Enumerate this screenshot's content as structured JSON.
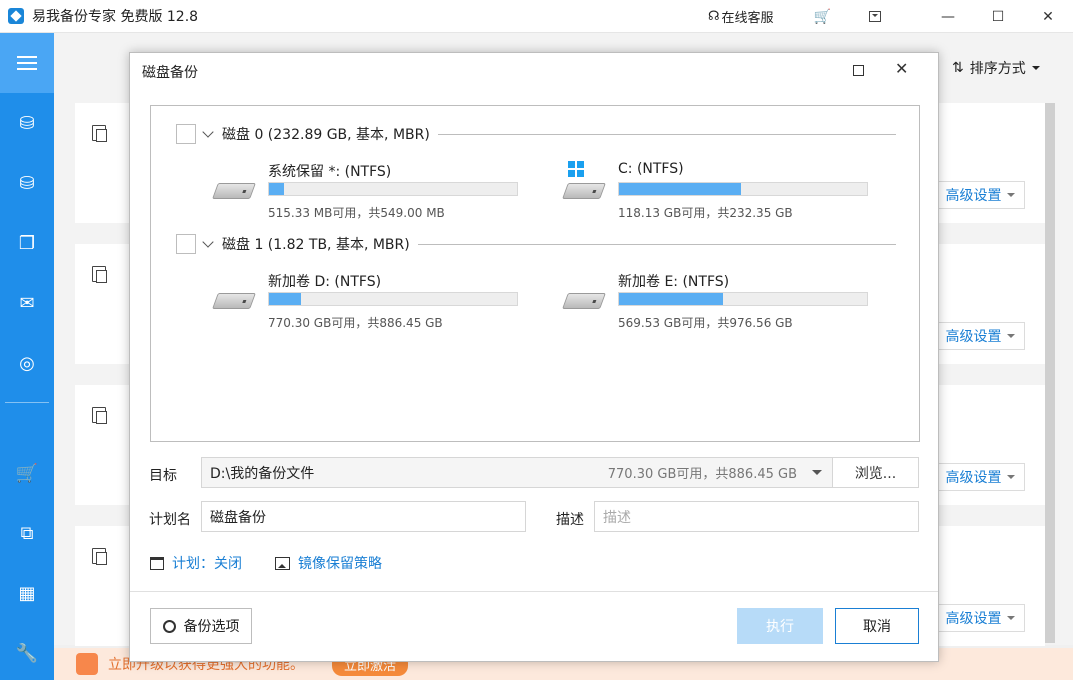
{
  "app": {
    "title": "易我备份专家 免费版 12.8",
    "support_label": "在线客服"
  },
  "main": {
    "sort_label": "排序方式",
    "advanced_label": "高级设置"
  },
  "promo": {
    "text": "立即升级以获得更强大的功能。",
    "button": "立即激活"
  },
  "dialog": {
    "title": "磁盘备份",
    "disks": [
      {
        "label": "磁盘 0 (232.89 GB, 基本, MBR)",
        "partitions": [
          {
            "name": "系统保留 *: (NTFS)",
            "size": "515.33 MB可用，共549.00 MB",
            "used_fraction": 0.06,
            "icon": "drive-icon"
          },
          {
            "name": "C: (NTFS)",
            "size": "118.13 GB可用，共232.35 GB",
            "used_fraction": 0.49,
            "icon": "windows-drive-icon"
          }
        ]
      },
      {
        "label": "磁盘 1 (1.82 TB, 基本, MBR)",
        "partitions": [
          {
            "name": "新加卷 D: (NTFS)",
            "size": "770.30 GB可用，共886.45 GB",
            "used_fraction": 0.13,
            "icon": "drive-icon"
          },
          {
            "name": "新加卷 E: (NTFS)",
            "size": "569.53 GB可用，共976.56 GB",
            "used_fraction": 0.42,
            "icon": "drive-icon"
          }
        ]
      }
    ],
    "target_label": "目标",
    "target_value": "D:\\我的备份文件",
    "target_info": "770.30 GB可用，共886.45 GB",
    "browse_label": "浏览...",
    "plan_name_label": "计划名",
    "plan_name_value": "磁盘备份",
    "description_label": "描述",
    "description_placeholder": "描述",
    "schedule_link": "计划：关闭",
    "retention_link": "镜像保留策略",
    "backup_options_label": "备份选项",
    "run_label": "执行",
    "cancel_label": "取消"
  },
  "colors": {
    "sidebar": "#1f8eea",
    "accent": "#1a7fd4",
    "bar_fill": "#5aaef3",
    "run_disabled": "#b7dbf8"
  }
}
